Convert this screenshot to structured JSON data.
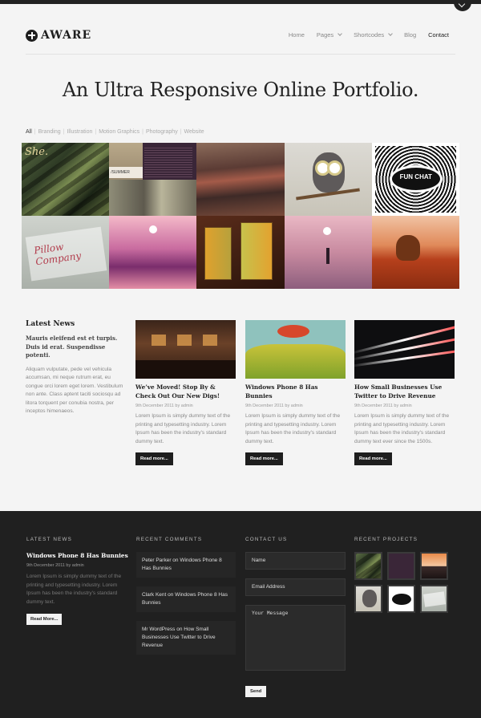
{
  "brand": {
    "logo_text": "AWARE"
  },
  "nav": {
    "items": [
      {
        "label": "Home",
        "dropdown": false,
        "active": false
      },
      {
        "label": "Pages",
        "dropdown": true,
        "active": false
      },
      {
        "label": "Shortcodes",
        "dropdown": true,
        "active": false
      },
      {
        "label": "Blog",
        "dropdown": false,
        "active": false
      },
      {
        "label": "Contact",
        "dropdown": false,
        "active": true
      }
    ]
  },
  "hero": {
    "title": "An Ultra Responsive Online Portfolio."
  },
  "filters": [
    "All",
    "Branding",
    "Illustration",
    "Motion Graphics",
    "Photography",
    "Website"
  ],
  "portfolio": {
    "tile_text": {
      "she": "She.",
      "summer": "/SUMMER",
      "funchat": "FUN CHAT",
      "pillow": "Pillow Company"
    }
  },
  "latest_news": {
    "title": "Latest News",
    "lead": "Mauris eleifend est et turpis. Duis id erat. Suspendisse potenti.",
    "body": "Aliquam vulputate, pede vel vehicula accumsan, mi neque rutrum erat, eu congue orci lorem eget lorem. Vestibulum non ante. Class aptent taciti sociosqu ad litora torquent per conubia nostra, per inceptos himenaeos."
  },
  "posts": [
    {
      "title": "We’ve Moved! Stop By & Check Out Our New Digs!",
      "meta": "9th December 2011 by admin",
      "body": "Lorem Ipsum is simply dummy text of the printing and typesetting industry. Lorem Ipsum has been the industry's standard dummy text.",
      "button": "Read more..."
    },
    {
      "title": "Windows Phone 8 Has Bunnies",
      "meta": "9th December 2011 by admin",
      "body": "Lorem Ipsum is simply dummy text of the printing and typesetting industry. Lorem Ipsum has been the industry's standard dummy text.",
      "button": "Read more..."
    },
    {
      "title": "How Small Businesses Use Twitter to Drive Revenue",
      "meta": "9th December 2011 by admin",
      "body": "Lorem Ipsum is simply dummy text of the printing and typesetting industry. Lorem Ipsum has been the industry's standard dummy text ever since the 1500s.",
      "button": "Read more..."
    }
  ],
  "footer": {
    "latest_news": {
      "heading": "LATEST NEWS",
      "title": "Windows Phone 8 Has Bunnies",
      "meta": "9th December 2011 by admin",
      "body": "Lorem Ipsum is simply dummy text of the printing and typesetting industry. Lorem Ipsum has been the industry's standard dummy text.",
      "button": "Read More..."
    },
    "recent_comments": {
      "heading": "RECENT COMMENTS",
      "items": [
        "Peter Parker on Windows Phone 8 Has Bunnies",
        "Clark Kent on Windows Phone 8 Has Bunnies",
        "Mr WordPress on How Small Businesses Use Twitter to Drive Revenue"
      ]
    },
    "contact": {
      "heading": "CONTACT US",
      "name_placeholder": "Name",
      "email_placeholder": "Email Address",
      "message_placeholder": "Your Message",
      "send": "Send"
    },
    "recent_projects": {
      "heading": "RECENT PROJECTS"
    }
  }
}
